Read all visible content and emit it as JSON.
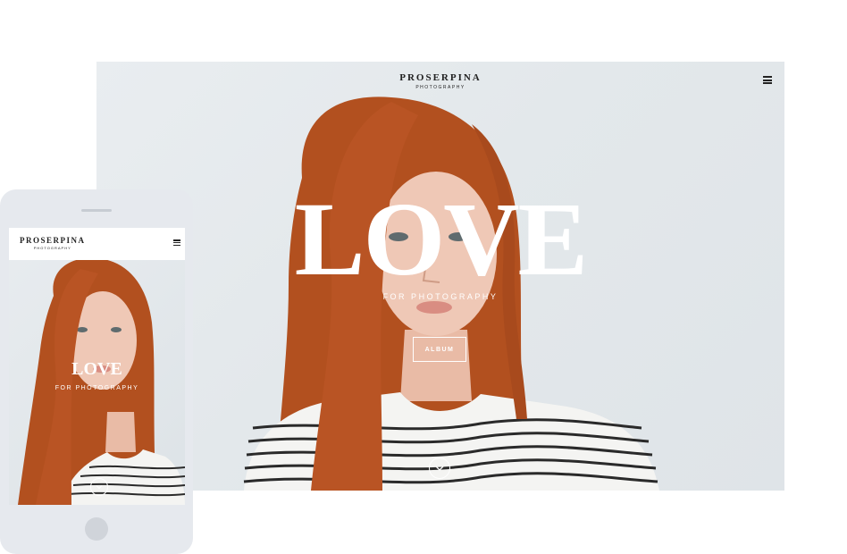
{
  "brand": {
    "name": "PROSERPINA",
    "tagline": "PHOTOGRAPHY"
  },
  "hero": {
    "title": "LOVE",
    "subtitle": "FOR PHOTOGRAPHY",
    "button_label": "ALBUM"
  },
  "icons": {
    "menu": "hamburger-menu-icon",
    "scroll": "chevron-down-circle-icon"
  },
  "colors": {
    "hair": "#b2501f",
    "skin": "#efc8b6",
    "background": "#e3e8eb",
    "device": "#e6e9ee",
    "text_dark": "#222222",
    "text_light": "#ffffff"
  }
}
